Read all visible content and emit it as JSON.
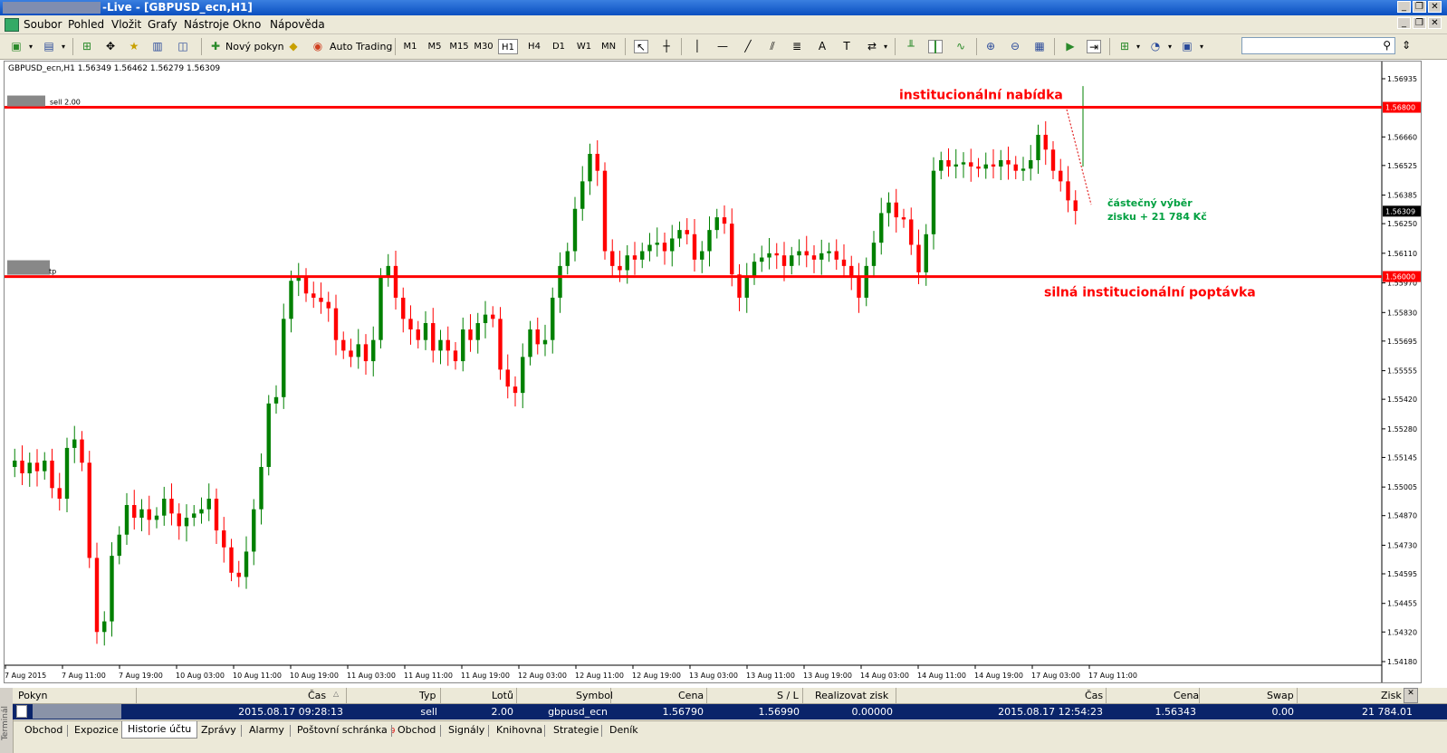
{
  "window": {
    "title": "-Live - [GBPUSD_ecn,H1]"
  },
  "menu": [
    "Soubor",
    "Pohled",
    "Vložit",
    "Grafy",
    "Nástroje",
    "Okno",
    "Nápověda"
  ],
  "toolbar": {
    "new_order_label": "Nový pokyn",
    "auto_trading_label": "Auto Trading",
    "timeframes": [
      "M1",
      "M5",
      "M15",
      "M30",
      "H1",
      "H4",
      "D1",
      "W1",
      "MN"
    ],
    "active_timeframe": "H1",
    "search_placeholder": ""
  },
  "chart_data": {
    "type": "candlestick",
    "symbol_header": "GBPUSD_ecn,H1  1.56349 1.56462 1.56279 1.56309",
    "colors": {
      "up": "#008000",
      "down": "#ff0000",
      "level_line": "#ff0000",
      "annotation_profit": "#00a040"
    },
    "y_ticks": [
      "1.56935",
      "1.56660",
      "1.56525",
      "1.56385",
      "1.56250",
      "1.56110",
      "1.55970",
      "1.55830",
      "1.55695",
      "1.55555",
      "1.55420",
      "1.55280",
      "1.55145",
      "1.55005",
      "1.54870",
      "1.54730",
      "1.54595",
      "1.54455",
      "1.54320",
      "1.54180"
    ],
    "x_ticks": [
      "7 Aug 2015",
      "7 Aug 11:00",
      "7 Aug 19:00",
      "10 Aug 03:00",
      "10 Aug 11:00",
      "10 Aug 19:00",
      "11 Aug 03:00",
      "11 Aug 11:00",
      "11 Aug 19:00",
      "12 Aug 03:00",
      "12 Aug 11:00",
      "12 Aug 19:00",
      "13 Aug 03:00",
      "13 Aug 11:00",
      "13 Aug 19:00",
      "14 Aug 03:00",
      "14 Aug 11:00",
      "14 Aug 19:00",
      "17 Aug 03:00",
      "17 Aug 11:00"
    ],
    "levels": [
      {
        "price": 1.568,
        "label": "1.56800",
        "order_tag": "sell 2.00",
        "annotation": "institucionální nabídka"
      },
      {
        "price": 1.56,
        "label": "1.56000",
        "order_tag": "tp",
        "annotation": "silná institucionální poptávka"
      }
    ],
    "current_price_label": "1.56309",
    "profit_note": [
      "částečný výběr",
      "zisku + 21 784 Kč"
    ]
  },
  "terminal": {
    "side_label": "Terminál",
    "columns": [
      "Pokyn",
      "Čas",
      "Typ",
      "Lotů",
      "Symbol",
      "Cena",
      "S / L",
      "Realizovat zisk",
      "Čas",
      "Cena",
      "Swap",
      "Zisk"
    ],
    "row": {
      "time_open": "2015.08.17 09:28:13",
      "type": "sell",
      "lots": "2.00",
      "symbol": "gbpusd_ecn",
      "price": "1.56790",
      "sl": "1.56990",
      "tp": "0.00000",
      "time_close": "2015.08.17 12:54:23",
      "close_price": "1.56343",
      "swap": "0.00",
      "profit": "21 784.01"
    },
    "tabs": [
      "Obchod",
      "Expozice",
      "Historie účtu",
      "Zprávy",
      "Alarmy",
      "Poštovní schránka",
      "Obchod",
      "Signály",
      "Knihovna",
      "Strategie",
      "Deník"
    ],
    "mailbox_badge": "9",
    "active_tab": "Historie účtu"
  }
}
